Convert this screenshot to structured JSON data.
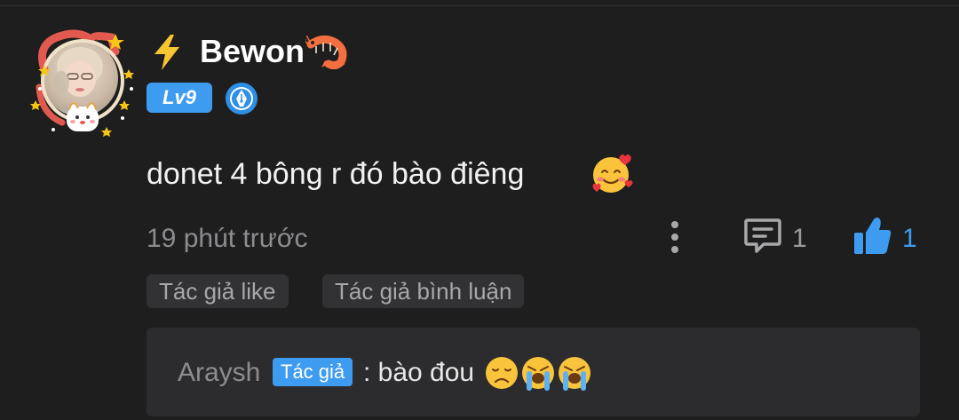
{
  "comment": {
    "username": "Bewon",
    "level": "Lv9",
    "text": "donet 4 bông r đó bào điêng",
    "timestamp": "19 phút trước",
    "reply_count": "1",
    "like_count": "1",
    "tags": [
      "Tác giả like",
      "Tác giả bình luận"
    ]
  },
  "reply": {
    "author": "Araysh",
    "author_badge": "Tác giả",
    "text": ": bào đou"
  },
  "icons": {
    "name_prefix": "lightning-bolt-icon",
    "name_suffix": "shrimp-icon",
    "badge": "pen-nib-badge-icon",
    "comment_emoji": "smiling-face-with-hearts-emoji",
    "reply_emojis": [
      "disappointed-face-emoji",
      "loudly-crying-face-emoji",
      "loudly-crying-face-emoji"
    ],
    "more": "vertical-dots-icon",
    "reply": "comment-bubble-icon",
    "like": "thumbs-up-icon"
  },
  "colors": {
    "background": "#1e1e1f",
    "accent": "#3d9bf0",
    "muted_text": "#8d8d90",
    "tag_background": "#323234",
    "reply_background": "#2c2c2e"
  }
}
